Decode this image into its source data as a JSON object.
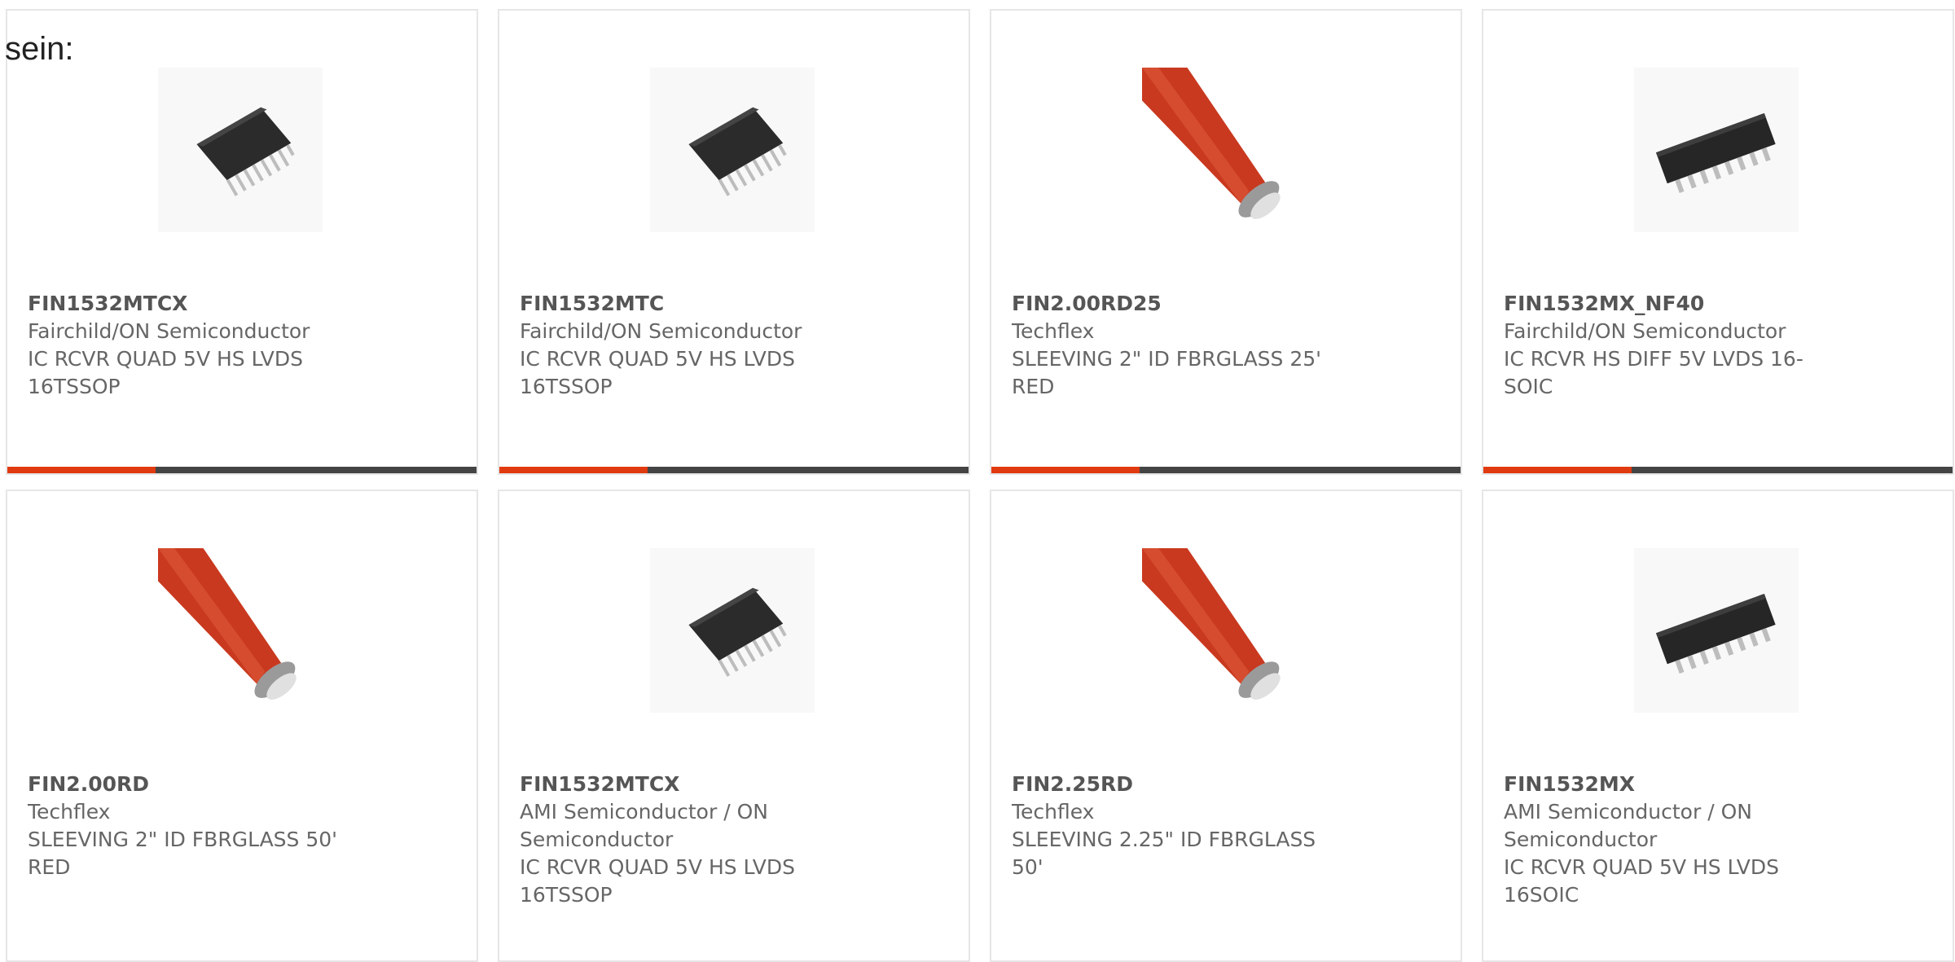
{
  "intro_text": "sein:",
  "colors": {
    "accent": "#e03a10",
    "bar_dark": "#444444",
    "card_border": "#e6e6e6",
    "text": "#666666"
  },
  "products": [
    {
      "part": "FIN1532MTCX",
      "manufacturer": "Fairchild/ON Semiconductor",
      "desc": "IC RCVR QUAD 5V HS LVDS 16TSSOP",
      "image_icon": "tssop-chip-icon"
    },
    {
      "part": "FIN1532MTC",
      "manufacturer": "Fairchild/ON Semiconductor",
      "desc": "IC RCVR QUAD 5V HS LVDS 16TSSOP",
      "image_icon": "tssop-chip-icon"
    },
    {
      "part": "FIN2.00RD25",
      "manufacturer": "Techflex",
      "desc": "SLEEVING 2\" ID FBRGLASS 25' RED",
      "image_icon": "red-sleeving-icon"
    },
    {
      "part": "FIN1532MX_NF40",
      "manufacturer": "Fairchild/ON Semiconductor",
      "desc": "IC RCVR HS DIFF 5V LVDS 16-SOIC",
      "image_icon": "soic-chip-icon"
    },
    {
      "part": "FIN2.00RD",
      "manufacturer": "Techflex",
      "desc": "SLEEVING 2\" ID FBRGLASS 50' RED",
      "image_icon": "red-sleeving-icon"
    },
    {
      "part": "FIN1532MTCX",
      "manufacturer": "AMI Semiconductor / ON Semiconductor",
      "desc": "IC RCVR QUAD 5V HS LVDS 16TSSOP",
      "image_icon": "tssop-chip-icon"
    },
    {
      "part": "FIN2.25RD",
      "manufacturer": "Techflex",
      "desc": "SLEEVING 2.25\" ID FBRGLASS 50'",
      "image_icon": "red-sleeving-icon"
    },
    {
      "part": "FIN1532MX",
      "manufacturer": "AMI Semiconductor / ON Semiconductor",
      "desc": "IC RCVR QUAD 5V HS LVDS 16SOIC",
      "image_icon": "soic-chip-icon"
    }
  ]
}
